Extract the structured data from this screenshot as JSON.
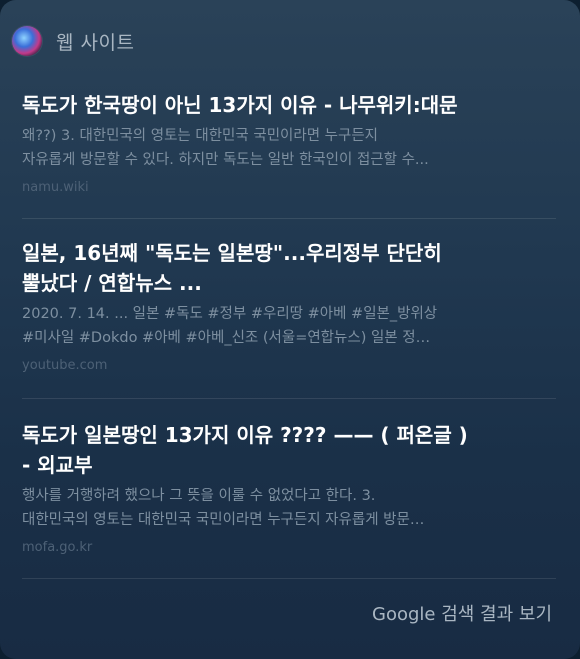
{
  "header": {
    "icon": "siri-icon",
    "title": "웹 사이트"
  },
  "results": [
    {
      "title_line1": "독도가 한국땅이 아닌 13가지 이유 - 나무위키:대문",
      "snippet_line1": "왜??) 3. 대한민국의 영토는 대한민국 국민이라면 누구든지",
      "snippet_line2": "자유롭게 방문할 수 있다. 하지만 독도는 일반 한국인이 접근할 수...",
      "source": "namu.wiki"
    },
    {
      "title_line1": "일본, 16년째 \"독도는 일본땅\"...우리정부 단단히",
      "title_line2": "뿔났다 / 연합뉴스 ...",
      "snippet_line1": "2020. 7. 14. ... 일본 #독도 #정부 #우리땅 #아베 #일본_방위상",
      "snippet_line2": "#미사일 #Dokdo #아베 #아베_신조 (서울=연합뉴스) 일본 정…",
      "source": "youtube.com"
    },
    {
      "title_line1": "독도가 일본땅인 13가지 이유 ???? —— ( 퍼온글 )",
      "title_line2": "- 외교부",
      "snippet_line1": "행사를 거행하려 했으나 그 뜻을 이룰 수 없었다고 한다. 3.",
      "snippet_line2": "대한민국의 영토는 대한민국 국민이라면 누구든지 자유롭게 방문…",
      "source": "mofa.go.kr"
    }
  ],
  "footer": {
    "label": "Google 검색 결과 보기"
  }
}
